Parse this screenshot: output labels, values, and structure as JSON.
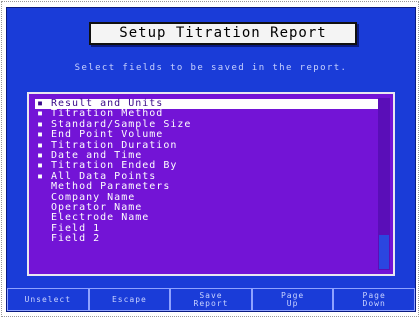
{
  "window": {
    "title": "Setup Titration Report",
    "instruction": "Select fields to be saved in the report."
  },
  "fields": [
    {
      "label": "Result and Units",
      "selected": true,
      "highlighted": true
    },
    {
      "label": "Titration Method",
      "selected": true,
      "highlighted": false
    },
    {
      "label": "Standard/Sample Size",
      "selected": true,
      "highlighted": false
    },
    {
      "label": "End Point Volume",
      "selected": true,
      "highlighted": false
    },
    {
      "label": "Titration Duration",
      "selected": true,
      "highlighted": false
    },
    {
      "label": "Date and Time",
      "selected": true,
      "highlighted": false
    },
    {
      "label": "Titration Ended By",
      "selected": true,
      "highlighted": false
    },
    {
      "label": "All Data Points",
      "selected": true,
      "highlighted": false
    },
    {
      "label": "Method Parameters",
      "selected": false,
      "highlighted": false
    },
    {
      "label": "Company Name",
      "selected": false,
      "highlighted": false
    },
    {
      "label": "Operator Name",
      "selected": false,
      "highlighted": false
    },
    {
      "label": "Electrode Name",
      "selected": false,
      "highlighted": false
    },
    {
      "label": "Field 1",
      "selected": false,
      "highlighted": false
    },
    {
      "label": "Field 2",
      "selected": false,
      "highlighted": false
    }
  ],
  "selected_marker": "▪",
  "softkeys": [
    {
      "line1": "Unselect",
      "line2": ""
    },
    {
      "line1": "Escape",
      "line2": ""
    },
    {
      "line1": "Save",
      "line2": "Report"
    },
    {
      "line1": "Page",
      "line2": "Up"
    },
    {
      "line1": "Page",
      "line2": "Down"
    }
  ],
  "colors": {
    "screen_bg": "#1a3cd8",
    "list_bg": "#7314d6",
    "text": "#ffffff",
    "highlight_bg": "#ffffff"
  }
}
